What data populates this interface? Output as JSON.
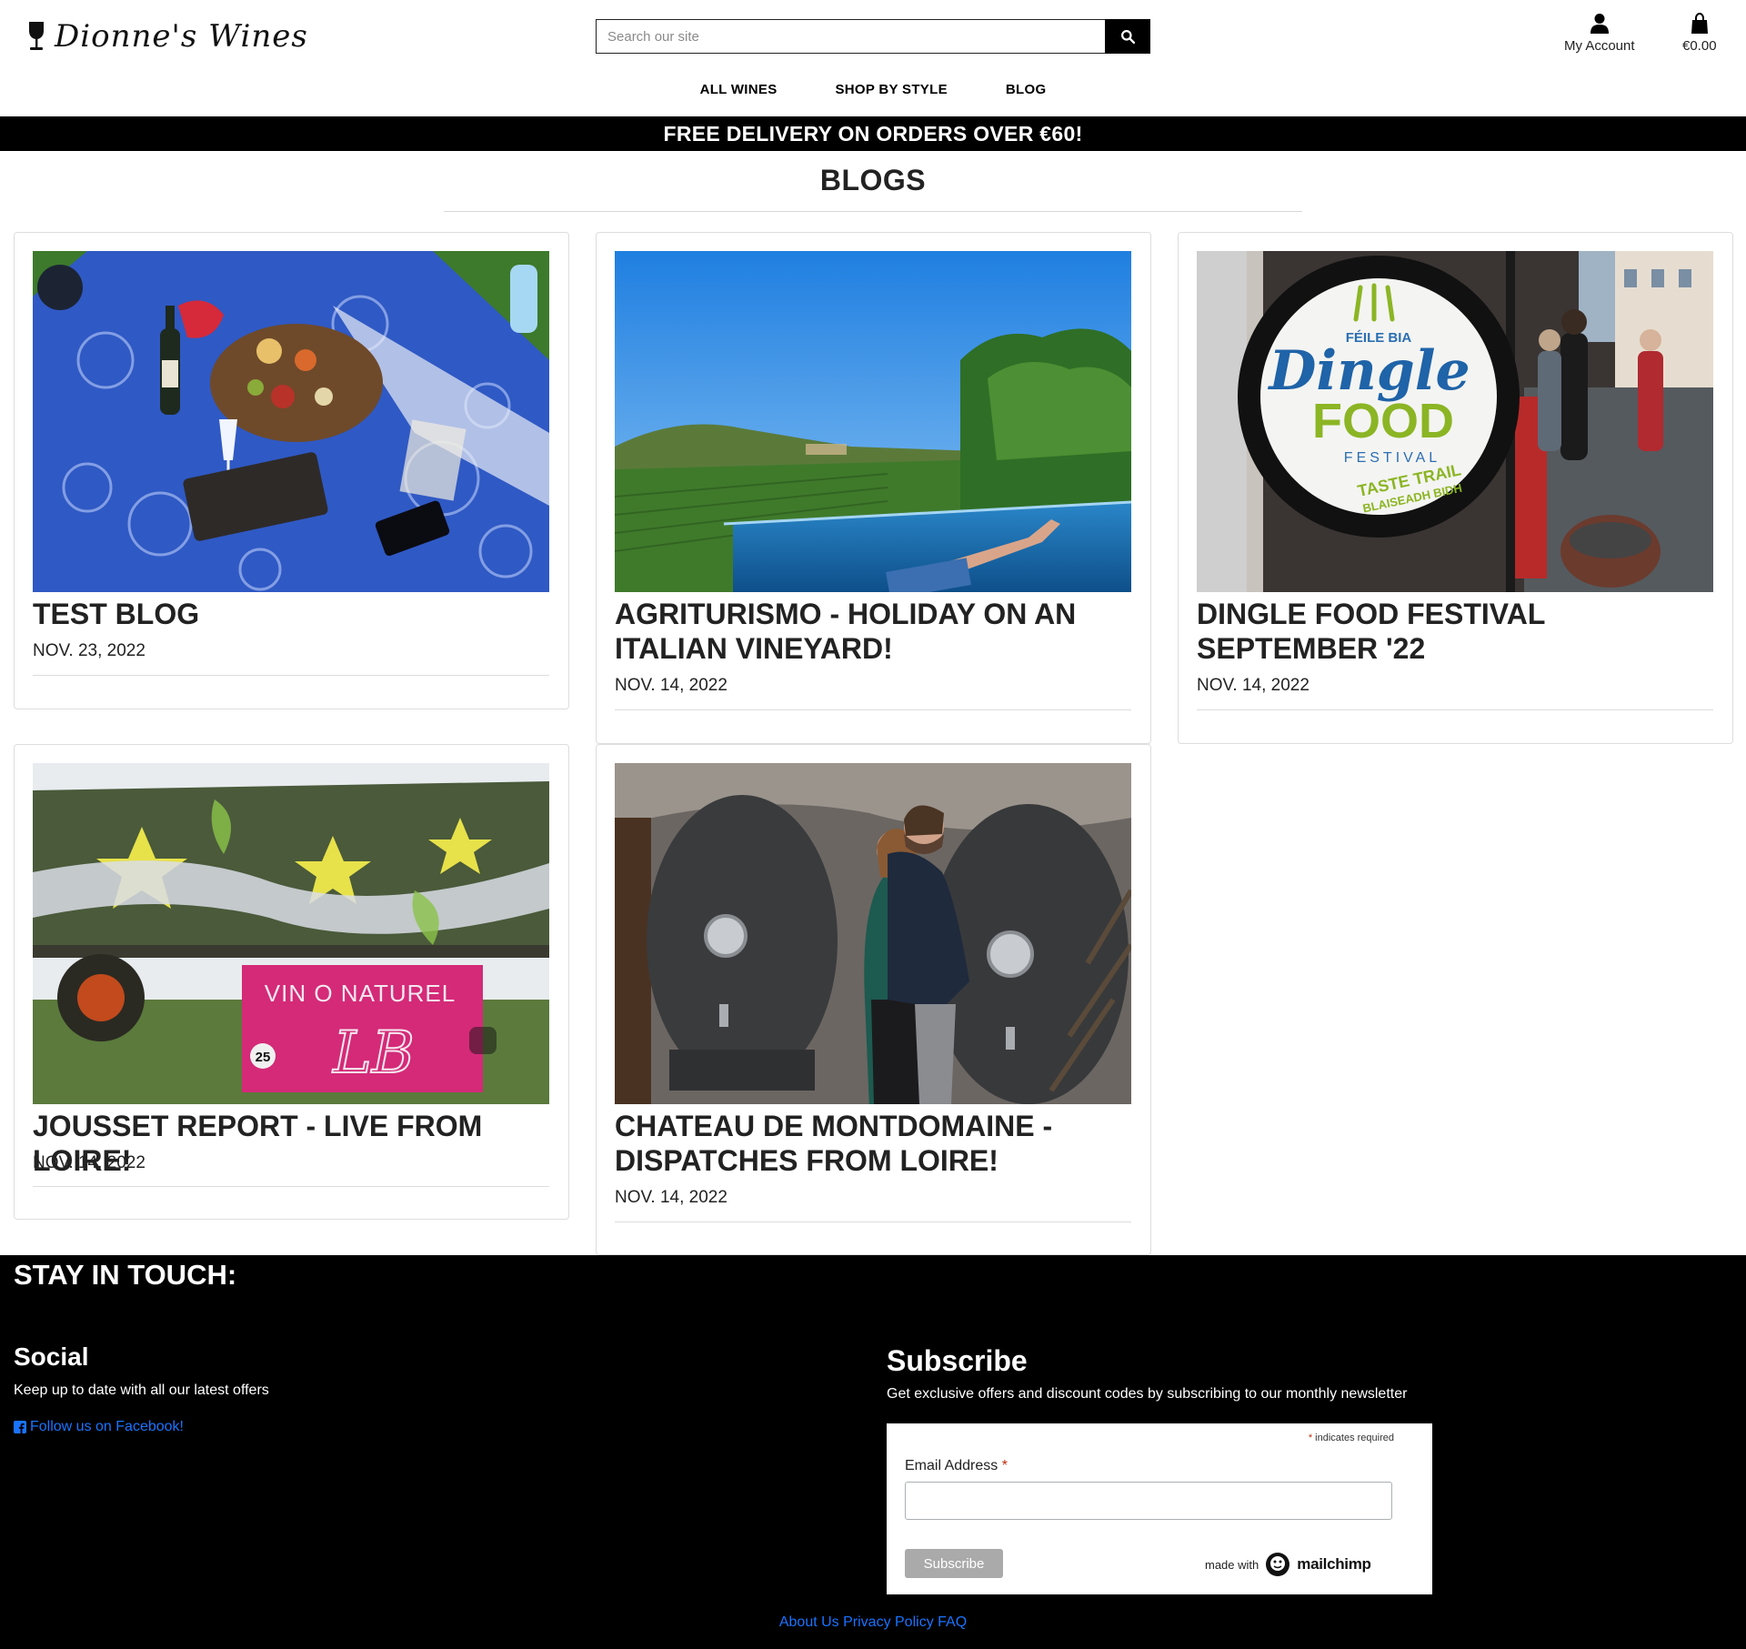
{
  "brand": {
    "name": "Dionne's Wines"
  },
  "search": {
    "placeholder": "Search our site"
  },
  "account": {
    "label": "My Account"
  },
  "bag": {
    "total": "€0.00"
  },
  "nav": {
    "items": [
      "ALL WINES",
      "SHOP BY STYLE",
      "BLOG"
    ]
  },
  "banner": {
    "text": "FREE DELIVERY ON ORDERS OVER €60!"
  },
  "page": {
    "title": "BLOGS"
  },
  "posts": [
    {
      "title": "TEST BLOG",
      "date": "NOV. 23, 2022",
      "image": "picnic-blanket-with-wine-and-charcuterie"
    },
    {
      "title": "AGRITURISMO - HOLIDAY ON AN ITALIAN VINEYARD!",
      "date": "NOV. 14, 2022",
      "image": "infinity-pool-overlooking-vineyards"
    },
    {
      "title": "DINGLE FOOD FESTIVAL SEPTEMBER '22",
      "date": "NOV. 14, 2022",
      "image": "dingle-food-festival-sign-on-street"
    },
    {
      "title": "JOUSSET REPORT - LIVE FROM LOIRE!",
      "date": "NOV. 14, 2022",
      "image": "painted-trailer-vin-o-naturel"
    },
    {
      "title": "CHATEAU DE MONTDOMAINE - DISPATCHES FROM LOIRE!",
      "date": "NOV. 14, 2022",
      "image": "couple-between-concrete-egg-tanks-in-cellar"
    }
  ],
  "images": {
    "dingle": {
      "line1": "FÉILE BIA",
      "line2": "Dingle",
      "line3": "FOOD",
      "line4": "FESTIVAL",
      "line5": "TASTE TRAIL",
      "line6": "BLAISEADH BIDH"
    },
    "trailer": {
      "line1": "VIN O NATUREL",
      "line2": "LB",
      "badge": "25"
    }
  },
  "footer": {
    "heading": "STAY IN TOUCH:",
    "social": {
      "heading": "Social",
      "text": "Keep up to date with all our latest offers",
      "link": "Follow us on Facebook!"
    },
    "subscribe": {
      "heading": "Subscribe",
      "text": "Get exclusive offers and discount codes by subscribing to our monthly newsletter",
      "required_note": "indicates required",
      "asterisk": "*",
      "email_label": "Email Address",
      "button": "Subscribe",
      "made_with": "made with",
      "brand": "mailchimp"
    },
    "links": [
      "About Us",
      "Privacy Policy",
      "FAQ"
    ]
  },
  "colors": {
    "link": "#1a73ff",
    "banner_bg": "#000000",
    "footer_bg": "#000000",
    "required": "#c02b0a"
  }
}
